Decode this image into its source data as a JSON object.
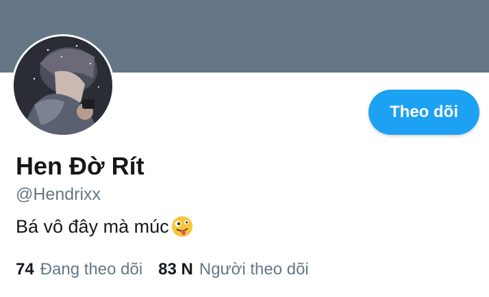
{
  "profile": {
    "name": "Hen Đờ Rít",
    "handle": "@Hendrixx",
    "bio": "Bá vô đây mà múc",
    "bio_emoji": "zany-face-icon"
  },
  "actions": {
    "follow_label": "Theo dõi"
  },
  "stats": {
    "following_count": "74",
    "following_label": "Đang theo dõi",
    "followers_count": "83 N",
    "followers_label": "Người theo dõi"
  },
  "colors": {
    "banner": "#657786",
    "accent": "#1da1f2",
    "text_primary": "#14171a",
    "text_secondary": "#657786"
  }
}
